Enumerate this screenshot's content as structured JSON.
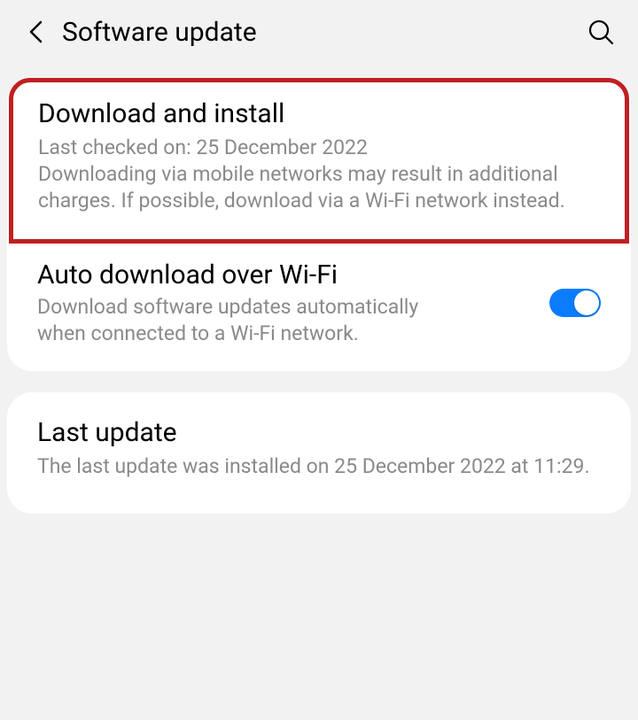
{
  "header": {
    "title": "Software update"
  },
  "downloadInstall": {
    "title": "Download and install",
    "lastChecked": "Last checked on: 25 December 2022",
    "warning": "Downloading via mobile networks may result in additional charges. If possible, download via a Wi-Fi network instead."
  },
  "autoDownload": {
    "title": "Auto download over Wi-Fi",
    "desc": "Download software updates automatically when connected to a Wi-Fi network.",
    "enabled": true
  },
  "lastUpdate": {
    "title": "Last update",
    "desc": "The last update was installed on 25 December 2022 at 11:29."
  }
}
